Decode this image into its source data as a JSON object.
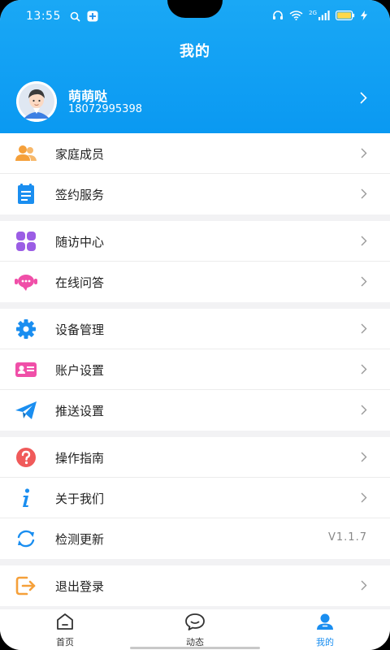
{
  "status_bar": {
    "time": "13:55",
    "network": "2G"
  },
  "header": {
    "title": "我的"
  },
  "profile": {
    "name": "萌萌哒",
    "phone": "18072995398"
  },
  "menu": {
    "groups": [
      {
        "items": [
          {
            "label": "家庭成员",
            "icon": "family-icon",
            "color": "#f5a03a"
          },
          {
            "label": "签约服务",
            "icon": "contract-icon",
            "color": "#1a8ef0"
          }
        ]
      },
      {
        "items": [
          {
            "label": "随访中心",
            "icon": "grid-icon",
            "color": "#9b5de5"
          },
          {
            "label": "在线问答",
            "icon": "chat-bubble-icon",
            "color": "#f04fa8"
          }
        ]
      },
      {
        "items": [
          {
            "label": "设备管理",
            "icon": "gear-icon",
            "color": "#1a8ef0"
          },
          {
            "label": "账户设置",
            "icon": "id-card-icon",
            "color": "#f04fa8"
          },
          {
            "label": "推送设置",
            "icon": "send-icon",
            "color": "#1a8ef0"
          }
        ]
      },
      {
        "items": [
          {
            "label": "操作指南",
            "icon": "help-icon",
            "color": "#f05a5a"
          },
          {
            "label": "关于我们",
            "icon": "info-icon",
            "color": "#1a8ef0"
          },
          {
            "label": "检测更新",
            "icon": "refresh-icon",
            "color": "#1a8ef0",
            "value": "V1.1.7"
          }
        ]
      },
      {
        "items": [
          {
            "label": "退出登录",
            "icon": "logout-icon",
            "color": "#f5a03a"
          }
        ]
      }
    ]
  },
  "bottom_nav": {
    "items": [
      {
        "label": "首页",
        "icon": "home-icon"
      },
      {
        "label": "动态",
        "icon": "message-icon"
      },
      {
        "label": "我的",
        "icon": "user-icon",
        "active": true
      }
    ],
    "active_color": "#1a8ef0"
  },
  "colors": {
    "header": "#0a99f2",
    "accent": "#1a8ef0",
    "background": "#f2f2f4"
  }
}
